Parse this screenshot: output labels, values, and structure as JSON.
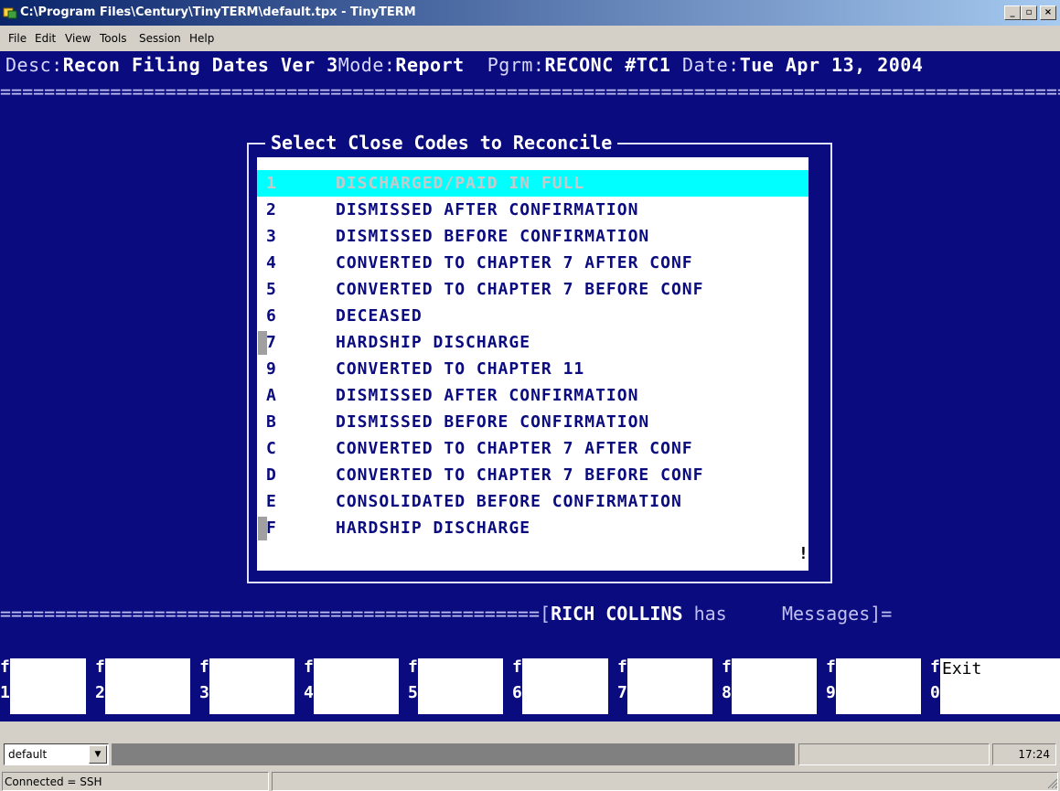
{
  "window": {
    "title": "C:\\Program Files\\Century\\TinyTERM\\default.tpx - TinyTERM",
    "controls": [
      "_",
      "▫",
      "×"
    ]
  },
  "menu": [
    "File",
    "Edit",
    "View",
    "Tools",
    "Session",
    "Help"
  ],
  "terminal": {
    "header": {
      "desc_label": "Desc:",
      "desc_value": "Recon Filing Dates Ver 3",
      "mode_label": "Mode:",
      "mode_value": "Report",
      "pgrm_label": "Pgrm:",
      "pgrm_value": "RECONC #TC1",
      "date_label": "Date:",
      "date_value": "Tue Apr 13, 2004"
    },
    "top_rule": "====================================================================================================",
    "dialog": {
      "title": "Select Close Codes to Reconcile",
      "items": [
        {
          "code": "1",
          "label": "DISCHARGED/PAID IN FULL",
          "selected": true
        },
        {
          "code": "2",
          "label": "DISMISSED AFTER CONFIRMATION"
        },
        {
          "code": "3",
          "label": "DISMISSED BEFORE CONFIRMATION"
        },
        {
          "code": "4",
          "label": "CONVERTED TO CHAPTER 7 AFTER CONF"
        },
        {
          "code": "5",
          "label": "CONVERTED TO CHAPTER 7 BEFORE CONF"
        },
        {
          "code": "6",
          "label": "DECEASED"
        },
        {
          "code": "7",
          "label": "HARDSHIP DISCHARGE",
          "marker": true
        },
        {
          "code": "9",
          "label": "CONVERTED TO CHAPTER 11"
        },
        {
          "code": "A",
          "label": "DISMISSED AFTER CONFIRMATION"
        },
        {
          "code": "B",
          "label": "DISMISSED BEFORE CONFIRMATION"
        },
        {
          "code": "C",
          "label": "CONVERTED TO CHAPTER 7 AFTER CONF"
        },
        {
          "code": "D",
          "label": "CONVERTED TO CHAPTER 7 BEFORE CONF"
        },
        {
          "code": "E",
          "label": "CONSOLIDATED BEFORE CONFIRMATION"
        },
        {
          "code": "F",
          "label": "HARDSHIP DISCHARGE",
          "marker": true
        }
      ],
      "scroll_indicator": "!"
    },
    "message_line": {
      "rule": "=================================================[",
      "user": "RICH COLLINS",
      "has": " has     ",
      "messages": "Messages]="
    },
    "fkeys": [
      {
        "f": "f",
        "n": "1",
        "label": ""
      },
      {
        "f": "f",
        "n": "2",
        "label": ""
      },
      {
        "f": "f",
        "n": "3",
        "label": ""
      },
      {
        "f": "f",
        "n": "4",
        "label": ""
      },
      {
        "f": "f",
        "n": "5",
        "label": ""
      },
      {
        "f": "f",
        "n": "6",
        "label": ""
      },
      {
        "f": "f",
        "n": "7",
        "label": ""
      },
      {
        "f": "f",
        "n": "8",
        "label": ""
      },
      {
        "f": "f",
        "n": "9",
        "label": ""
      },
      {
        "f": "f",
        "n": "0",
        "label": "Exit"
      }
    ]
  },
  "statusbar": {
    "session": "default",
    "time": "17:24",
    "connection": "Connected = SSH"
  },
  "colors": {
    "terminal_bg": "#0b0b80",
    "selection": "#00ffff",
    "chrome": "#d4d0c8",
    "titlebar_start": "#0a246a"
  }
}
